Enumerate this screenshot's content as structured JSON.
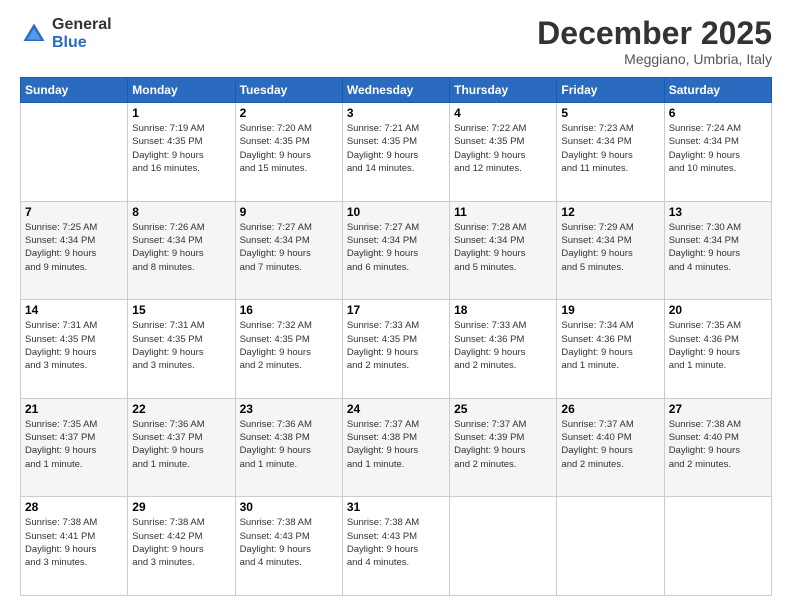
{
  "logo": {
    "general": "General",
    "blue": "Blue"
  },
  "header": {
    "month": "December 2025",
    "location": "Meggiano, Umbria, Italy"
  },
  "weekdays": [
    "Sunday",
    "Monday",
    "Tuesday",
    "Wednesday",
    "Thursday",
    "Friday",
    "Saturday"
  ],
  "weeks": [
    [
      {
        "day": "",
        "info": ""
      },
      {
        "day": "1",
        "info": "Sunrise: 7:19 AM\nSunset: 4:35 PM\nDaylight: 9 hours\nand 16 minutes."
      },
      {
        "day": "2",
        "info": "Sunrise: 7:20 AM\nSunset: 4:35 PM\nDaylight: 9 hours\nand 15 minutes."
      },
      {
        "day": "3",
        "info": "Sunrise: 7:21 AM\nSunset: 4:35 PM\nDaylight: 9 hours\nand 14 minutes."
      },
      {
        "day": "4",
        "info": "Sunrise: 7:22 AM\nSunset: 4:35 PM\nDaylight: 9 hours\nand 12 minutes."
      },
      {
        "day": "5",
        "info": "Sunrise: 7:23 AM\nSunset: 4:34 PM\nDaylight: 9 hours\nand 11 minutes."
      },
      {
        "day": "6",
        "info": "Sunrise: 7:24 AM\nSunset: 4:34 PM\nDaylight: 9 hours\nand 10 minutes."
      }
    ],
    [
      {
        "day": "7",
        "info": "Sunrise: 7:25 AM\nSunset: 4:34 PM\nDaylight: 9 hours\nand 9 minutes."
      },
      {
        "day": "8",
        "info": "Sunrise: 7:26 AM\nSunset: 4:34 PM\nDaylight: 9 hours\nand 8 minutes."
      },
      {
        "day": "9",
        "info": "Sunrise: 7:27 AM\nSunset: 4:34 PM\nDaylight: 9 hours\nand 7 minutes."
      },
      {
        "day": "10",
        "info": "Sunrise: 7:27 AM\nSunset: 4:34 PM\nDaylight: 9 hours\nand 6 minutes."
      },
      {
        "day": "11",
        "info": "Sunrise: 7:28 AM\nSunset: 4:34 PM\nDaylight: 9 hours\nand 5 minutes."
      },
      {
        "day": "12",
        "info": "Sunrise: 7:29 AM\nSunset: 4:34 PM\nDaylight: 9 hours\nand 5 minutes."
      },
      {
        "day": "13",
        "info": "Sunrise: 7:30 AM\nSunset: 4:34 PM\nDaylight: 9 hours\nand 4 minutes."
      }
    ],
    [
      {
        "day": "14",
        "info": "Sunrise: 7:31 AM\nSunset: 4:35 PM\nDaylight: 9 hours\nand 3 minutes."
      },
      {
        "day": "15",
        "info": "Sunrise: 7:31 AM\nSunset: 4:35 PM\nDaylight: 9 hours\nand 3 minutes."
      },
      {
        "day": "16",
        "info": "Sunrise: 7:32 AM\nSunset: 4:35 PM\nDaylight: 9 hours\nand 2 minutes."
      },
      {
        "day": "17",
        "info": "Sunrise: 7:33 AM\nSunset: 4:35 PM\nDaylight: 9 hours\nand 2 minutes."
      },
      {
        "day": "18",
        "info": "Sunrise: 7:33 AM\nSunset: 4:36 PM\nDaylight: 9 hours\nand 2 minutes."
      },
      {
        "day": "19",
        "info": "Sunrise: 7:34 AM\nSunset: 4:36 PM\nDaylight: 9 hours\nand 1 minute."
      },
      {
        "day": "20",
        "info": "Sunrise: 7:35 AM\nSunset: 4:36 PM\nDaylight: 9 hours\nand 1 minute."
      }
    ],
    [
      {
        "day": "21",
        "info": "Sunrise: 7:35 AM\nSunset: 4:37 PM\nDaylight: 9 hours\nand 1 minute."
      },
      {
        "day": "22",
        "info": "Sunrise: 7:36 AM\nSunset: 4:37 PM\nDaylight: 9 hours\nand 1 minute."
      },
      {
        "day": "23",
        "info": "Sunrise: 7:36 AM\nSunset: 4:38 PM\nDaylight: 9 hours\nand 1 minute."
      },
      {
        "day": "24",
        "info": "Sunrise: 7:37 AM\nSunset: 4:38 PM\nDaylight: 9 hours\nand 1 minute."
      },
      {
        "day": "25",
        "info": "Sunrise: 7:37 AM\nSunset: 4:39 PM\nDaylight: 9 hours\nand 2 minutes."
      },
      {
        "day": "26",
        "info": "Sunrise: 7:37 AM\nSunset: 4:40 PM\nDaylight: 9 hours\nand 2 minutes."
      },
      {
        "day": "27",
        "info": "Sunrise: 7:38 AM\nSunset: 4:40 PM\nDaylight: 9 hours\nand 2 minutes."
      }
    ],
    [
      {
        "day": "28",
        "info": "Sunrise: 7:38 AM\nSunset: 4:41 PM\nDaylight: 9 hours\nand 3 minutes."
      },
      {
        "day": "29",
        "info": "Sunrise: 7:38 AM\nSunset: 4:42 PM\nDaylight: 9 hours\nand 3 minutes."
      },
      {
        "day": "30",
        "info": "Sunrise: 7:38 AM\nSunset: 4:43 PM\nDaylight: 9 hours\nand 4 minutes."
      },
      {
        "day": "31",
        "info": "Sunrise: 7:38 AM\nSunset: 4:43 PM\nDaylight: 9 hours\nand 4 minutes."
      },
      {
        "day": "",
        "info": ""
      },
      {
        "day": "",
        "info": ""
      },
      {
        "day": "",
        "info": ""
      }
    ]
  ]
}
